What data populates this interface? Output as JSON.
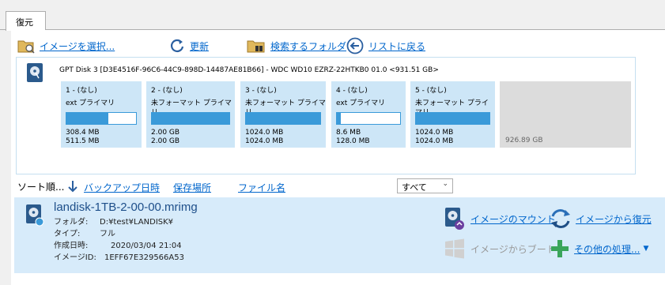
{
  "tab": {
    "label": "復元"
  },
  "toolbar": {
    "select_image": "イメージを選択...",
    "refresh": "更新",
    "search_folder": "検索するフォルダ",
    "back_to_list": "リストに戻る"
  },
  "disk": {
    "title": "GPT Disk 3 [D3E4516F-96C6-44C9-898D-14487AE81B66] - WDC WD10 EZRZ-22HTKB0    01.0  <931.51 GB>",
    "partitions": [
      {
        "name": "1 - (なし)",
        "type": "ext プライマリ",
        "used": "308.4 MB",
        "total": "511.5 MB",
        "fill": 0.6
      },
      {
        "name": "2 - (なし)",
        "type": "未フォーマット プライマリ",
        "used": "2.00 GB",
        "total": "2.00 GB",
        "fill": 1.0
      },
      {
        "name": "3 - (なし)",
        "type": "未フォーマット プライマリ",
        "used": "1024.0 MB",
        "total": "1024.0 MB",
        "fill": 1.0
      },
      {
        "name": "4 - (なし)",
        "type": "ext プライマリ",
        "used": "8.6 MB",
        "total": "128.0 MB",
        "fill": 0.067
      },
      {
        "name": "5 - (なし)",
        "type": "未フォーマット プライマリ",
        "used": "1024.0 MB",
        "total": "1024.0 MB",
        "fill": 1.0
      }
    ],
    "unallocated": "926.89 GB"
  },
  "sort": {
    "label": "ソート順...",
    "backup_date": "バックアップ日時",
    "location": "保存場所",
    "filename": "ファイル名",
    "filter_value": "すべて"
  },
  "image": {
    "name": "landisk-1TB-2-00-00.mrimg",
    "folder_key": "フォルダ:",
    "folder_val": "D:¥test¥LANDISK¥",
    "type_key": "タイプ:",
    "type_val": "フル",
    "created_key": "作成日時:",
    "created_val": "2020/03/04 21:04",
    "id_key": "イメージID:",
    "id_val": "1EFF67E329566A53"
  },
  "actions": {
    "mount": "イメージのマウント",
    "restore": "イメージから復元",
    "boot": "イメージからブート",
    "other": "その他の処理..."
  }
}
